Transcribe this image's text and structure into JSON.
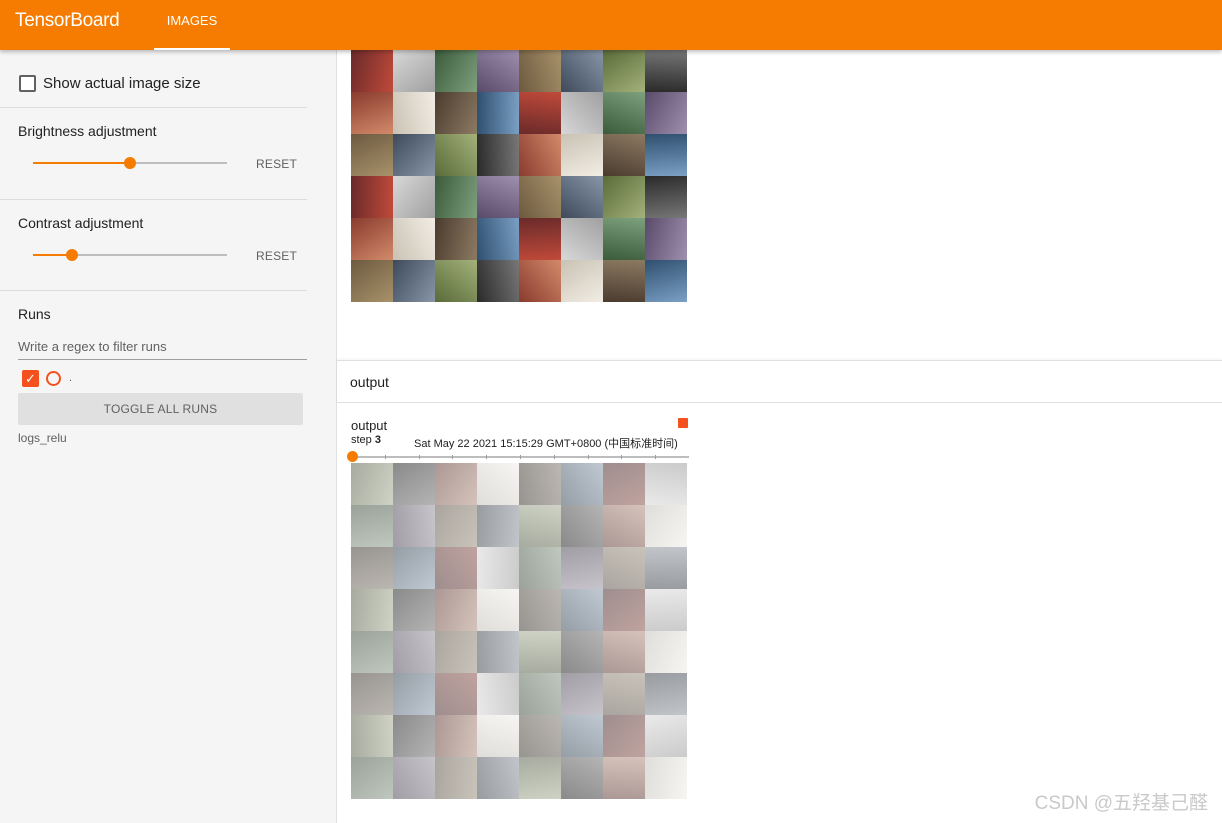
{
  "header": {
    "brand": "TensorBoard",
    "active_tab": "IMAGES",
    "accent_color": "#f57c00"
  },
  "sidebar": {
    "show_actual_size": {
      "label": "Show actual image size",
      "checked": false
    },
    "brightness": {
      "label": "Brightness adjustment",
      "value": 0.5,
      "reset_label": "RESET"
    },
    "contrast": {
      "label": "Contrast adjustment",
      "value": 0.2,
      "reset_label": "RESET"
    },
    "runs": {
      "title": "Runs",
      "filter_placeholder": "Write a regex to filter runs",
      "run_dot_label": ".",
      "toggle_all_label": "TOGGLE ALL RUNS",
      "run_name": "logs_relu",
      "run_color": "#f4511e"
    }
  },
  "main": {
    "category": "output",
    "card": {
      "title": "output",
      "step_label": "step",
      "step_value": "3",
      "timestamp": "Sat May 22 2021 15:15:29 GMT+0800 (中国标准时间)",
      "step_position": 0
    }
  },
  "watermark": "CSDN @五羟基己醛"
}
